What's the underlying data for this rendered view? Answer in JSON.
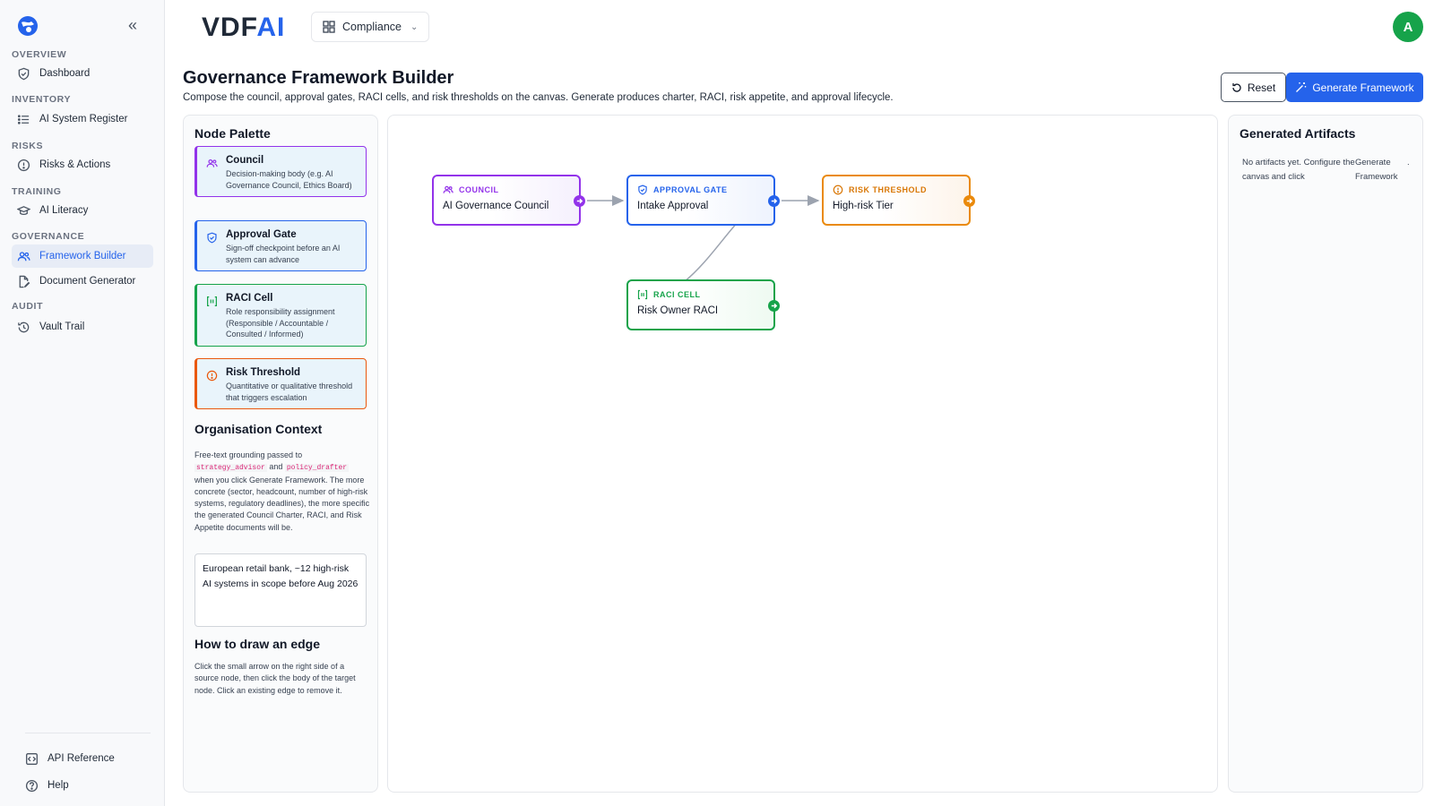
{
  "sidebar": {
    "sections": [
      {
        "label": "OVERVIEW",
        "items": [
          {
            "label": "Dashboard",
            "icon": "shield-check-icon"
          }
        ]
      },
      {
        "label": "INVENTORY",
        "items": [
          {
            "label": "AI System Register",
            "icon": "list-icon"
          }
        ]
      },
      {
        "label": "RISKS",
        "items": [
          {
            "label": "Risks & Actions",
            "icon": "alert-circle-icon"
          }
        ]
      },
      {
        "label": "TRAINING",
        "items": [
          {
            "label": "AI Literacy",
            "icon": "graduation-cap-icon"
          }
        ]
      },
      {
        "label": "GOVERNANCE",
        "items": [
          {
            "label": "Framework Builder",
            "icon": "users-icon",
            "active": true
          },
          {
            "label": "Document Generator",
            "icon": "file-edit-icon"
          }
        ]
      },
      {
        "label": "AUDIT",
        "items": [
          {
            "label": "Vault Trail",
            "icon": "history-icon"
          }
        ]
      }
    ],
    "footer": [
      {
        "label": "API Reference",
        "icon": "code-icon"
      },
      {
        "label": "Help",
        "icon": "help-circle-icon"
      }
    ]
  },
  "header": {
    "brand_main": "VDF",
    "brand_accent": "AI",
    "workspace": "Compliance",
    "avatar_initial": "A"
  },
  "page": {
    "title": "Governance Framework Builder",
    "subtitle": "Compose the council, approval gates, RACI cells, and risk thresholds on the canvas. Generate produces charter, RACI, risk appetite, and approval lifecycle.",
    "reset_label": "Reset",
    "generate_label": "Generate Framework"
  },
  "palette": {
    "title": "Node Palette",
    "cards": [
      {
        "title": "Council",
        "desc": "Decision-making body (e.g. AI Governance Council, Ethics Board)"
      },
      {
        "title": "Approval Gate",
        "desc": "Sign-off checkpoint before an AI system can advance"
      },
      {
        "title": "RACI Cell",
        "desc": "Role responsibility assignment (Responsible / Accountable / Consulted / Informed)"
      },
      {
        "title": "Risk Threshold",
        "desc": "Quantitative or qualitative threshold that triggers escalation"
      }
    ],
    "context": {
      "title": "Organisation Context",
      "desc_pre": "Free-text grounding passed to",
      "code1": "strategy_advisor",
      "and": "and",
      "code2": "policy_drafter",
      "desc_post": "when you click Generate Framework. The more concrete (sector, headcount, number of high-risk systems, regulatory deadlines), the more specific the generated Council Charter, RACI, and Risk Appetite documents will be.",
      "value": "European retail bank, ~12 high-risk AI systems in scope before Aug 2026"
    },
    "edge_help": {
      "title": "How to draw an edge",
      "desc": "Click the small arrow on the right side of a source node, then click the body of the target node. Click an existing edge to remove it."
    }
  },
  "canvas": {
    "nodes": [
      {
        "kind": "COUNCIL",
        "label": "AI Governance Council",
        "color": "#9333ea"
      },
      {
        "kind": "APPROVAL GATE",
        "label": "Intake Approval",
        "color": "#2563eb"
      },
      {
        "kind": "RISK THRESHOLD",
        "label": "High-risk Tier",
        "color": "#ea8a0c"
      },
      {
        "kind": "RACI CELL",
        "label": "Risk Owner RACI",
        "color": "#16a34a"
      }
    ],
    "edges": [
      {
        "from": "AI Governance Council",
        "to": "Intake Approval"
      },
      {
        "from": "Intake Approval",
        "to": "High-risk Tier"
      },
      {
        "from": "Intake Approval",
        "to": "Risk Owner RACI"
      }
    ]
  },
  "artifacts": {
    "title": "Generated Artifacts",
    "empty_text": "No artifacts yet. Configure the canvas and click",
    "empty_action": "Generate Framework",
    "empty_end": "."
  },
  "colors": {
    "accent": "#2563eb",
    "council": "#9333ea",
    "gate": "#2563eb",
    "raci": "#16a34a",
    "risk": "#ea580c",
    "avatar": "#16a34a"
  }
}
